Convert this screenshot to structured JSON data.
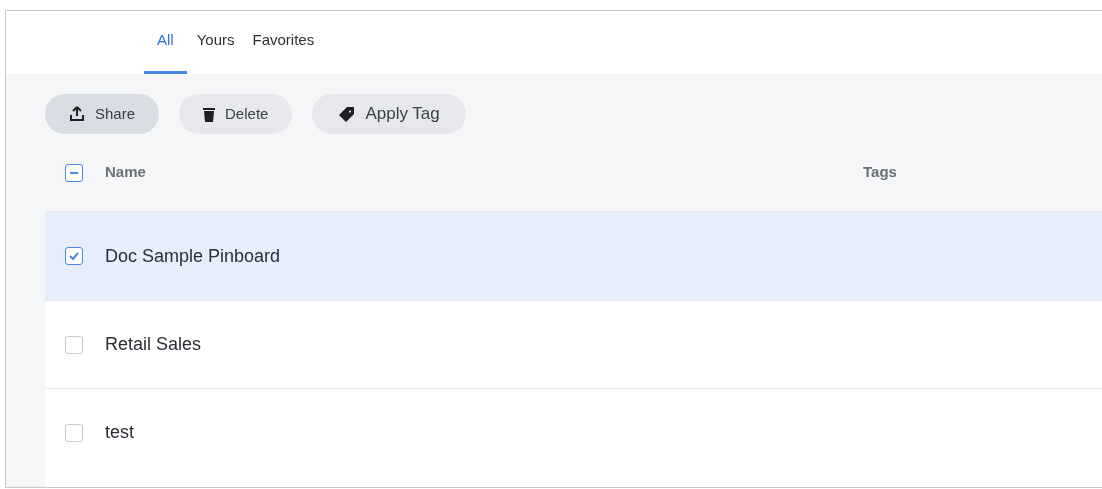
{
  "tabs": [
    {
      "label": "All",
      "selected": true
    },
    {
      "label": "Yours",
      "selected": false
    },
    {
      "label": "Favorites",
      "selected": false
    }
  ],
  "actions": [
    {
      "label": "Share",
      "kind": "share",
      "hovered": true
    },
    {
      "label": "Delete",
      "kind": "delete",
      "hovered": false
    },
    {
      "label": "Apply Tag",
      "kind": "tag",
      "hovered": false
    }
  ],
  "table": {
    "select_all": {
      "indeterminate": true
    },
    "columns": [
      "Name",
      "Tags"
    ],
    "rows": [
      {
        "name": "Doc Sample Pinboard",
        "checked": true
      },
      {
        "name": "Retail Sales",
        "checked": false
      },
      {
        "name": "test",
        "checked": false
      }
    ]
  }
}
